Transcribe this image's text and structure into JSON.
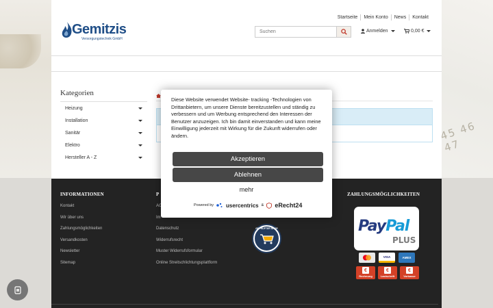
{
  "header": {
    "top_links": [
      "Startseite",
      "Mein Konto",
      "News",
      "Kontakt"
    ],
    "logo_text": "Gemitzis",
    "logo_subtitle": "Versorgungstechnik GmbH",
    "search_placeholder": "Suchen",
    "account_label": "Anmelden",
    "cart_label": "0,00 €"
  },
  "sidebar": {
    "title": "Kategorien",
    "items": [
      {
        "label": "Heizung"
      },
      {
        "label": "Installation"
      },
      {
        "label": "Sanitär"
      },
      {
        "label": "Elektro"
      },
      {
        "label": "Hersteller A - Z"
      }
    ]
  },
  "footer": {
    "col1": {
      "title": "INFORMATIONEN",
      "links": [
        "Kontakt",
        "Wir über uns",
        "Zahlungsmöglichkeiten",
        "Versandkosten",
        "Newsletter",
        "Sitemap"
      ]
    },
    "col2": {
      "title_fragment": "P",
      "links": [
        "AG",
        "Im",
        "Datenschutz",
        "Widerrufsrecht",
        "Muster Widerrufsformular",
        "Online Streitschlichtungsplattform"
      ]
    },
    "col4": {
      "title": "ZAHLUNGSMÖGLICHKEITEN",
      "paypal_part1": "Pay",
      "paypal_part2": "Pal",
      "paypal_plus": "PLUS",
      "cards": [
        "MC",
        "VISA",
        "AMEX"
      ],
      "pay_methods": [
        "Rechnung",
        "Lastschrift",
        "Vorkasse"
      ]
    },
    "seal_text": "GEPRÜFTER SHOP"
  },
  "cookie_modal": {
    "text": "Diese Website verwendet Website- tracking -Technologien von Drittanbietern, um unsere Dienste bereitzustellen und ständig zu verbessern und um Werbung entsprechend den Interessen der Benutzer anzuzeigen. Ich bin damit einverstanden und kann meine Einwilligung jederzeit mit Wirkung für die Zukunft widerrufen oder ändern.",
    "accept_label": "Akzeptieren",
    "deny_label": "Ablehnen",
    "more_label": "mehr",
    "powered_by": "Powered by",
    "usercentrics": "usercentrics",
    "and": "&",
    "erecht": "eRecht24"
  },
  "colors": {
    "brand_blue": "#1f4e87",
    "button_dark": "#474747",
    "footer_bg": "#232323",
    "paypal_dark": "#253b80",
    "paypal_light": "#179bd7"
  }
}
